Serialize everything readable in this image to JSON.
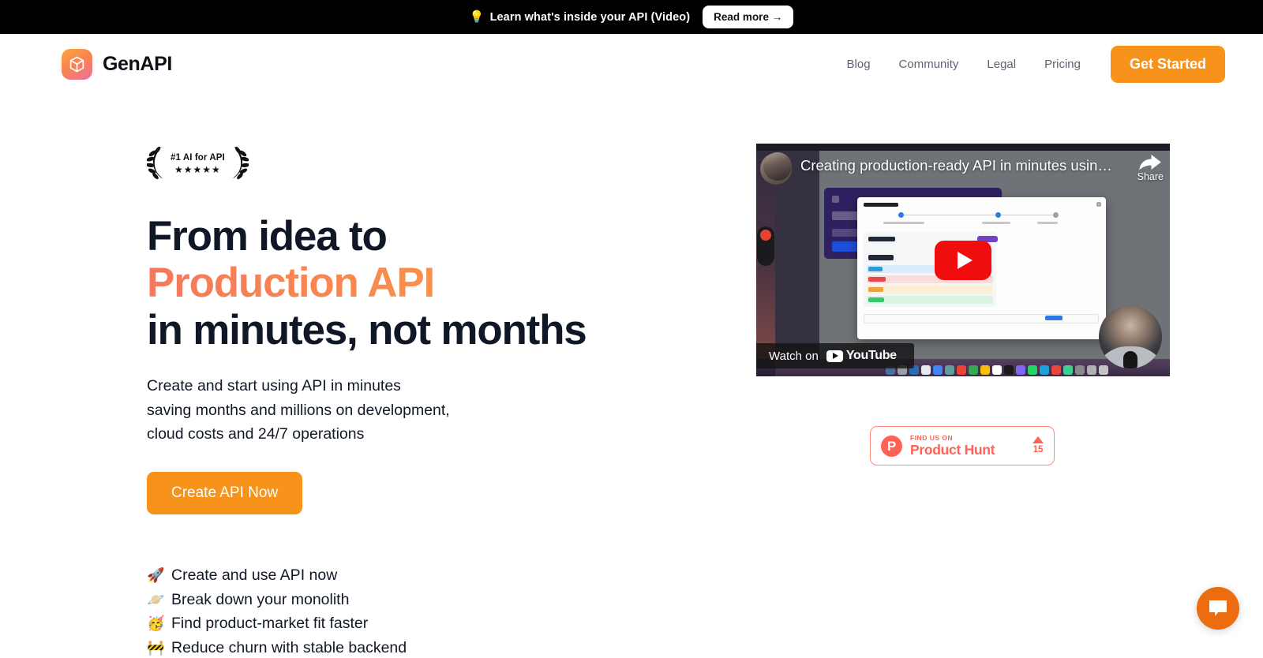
{
  "banner": {
    "emoji": "💡",
    "text": "Learn what's inside your API (Video)",
    "button_label": "Read more →"
  },
  "header": {
    "brand_name": "GenAPI",
    "brand_icon": "cube-icon",
    "nav": [
      {
        "label": "Blog"
      },
      {
        "label": "Community"
      },
      {
        "label": "Legal"
      },
      {
        "label": "Pricing"
      }
    ],
    "cta_label": "Get Started"
  },
  "hero": {
    "award": {
      "text": "#1 AI for API",
      "stars": "★★★★★"
    },
    "headline_line1": "From idea to",
    "headline_accent": "Production API",
    "headline_line3": "in minutes, not months",
    "subhead_line1": "Create and start using API in minutes",
    "subhead_line2": "saving months and millions on development,",
    "subhead_line3": "cloud costs and 24/7 operations",
    "cta_label": "Create API Now",
    "benefits": [
      {
        "emoji": "🚀",
        "label": "Create and use API now"
      },
      {
        "emoji": "🪐",
        "label": "Break down your monolith"
      },
      {
        "emoji": "🥳",
        "label": "Find product-market fit faster"
      },
      {
        "emoji": "🚧",
        "label": "Reduce churn with stable backend"
      }
    ]
  },
  "video": {
    "title": "Creating production-ready API in minutes using Ge…",
    "share_label": "Share",
    "watch_on_label": "Watch on",
    "platform": "YouTube",
    "play_icon": "play-icon"
  },
  "product_hunt": {
    "eyebrow": "FIND US ON",
    "name": "Product Hunt",
    "logo_letter": "P",
    "upvotes": "15"
  },
  "chat": {
    "icon": "chat-bubble-icon"
  },
  "colors": {
    "accent_orange": "#F7931A",
    "gradient_start": "#F4795E",
    "gradient_end": "#F9904B",
    "product_hunt": "#FF6154",
    "banner_bg": "#000000",
    "text_dark": "#101828",
    "nav_text": "#5a6472",
    "chat_fab": "#EC6C10"
  }
}
